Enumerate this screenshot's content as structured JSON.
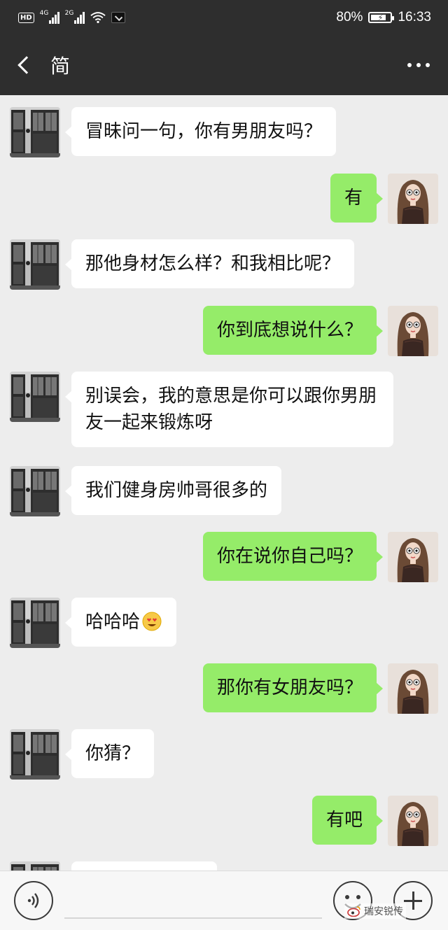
{
  "status_bar": {
    "hd": "HD",
    "network1": "4G",
    "network2": "2G",
    "battery_percent": "80%",
    "battery_level": 0.8,
    "time": "16:33"
  },
  "header": {
    "title": "简",
    "back_icon": "chevron-left-icon",
    "more_icon": "more-dots-icon"
  },
  "messages": [
    {
      "side": "left",
      "text": "冒昧问一句，你有男朋友吗？"
    },
    {
      "side": "right",
      "text": "有"
    },
    {
      "side": "left",
      "text": "那他身材怎么样？和我相比呢？"
    },
    {
      "side": "right",
      "text": "你到底想说什么？"
    },
    {
      "side": "left",
      "text": "别误会，我的意思是你可以跟你男朋友一起来锻炼呀"
    },
    {
      "side": "left",
      "text": "我们健身房帅哥很多的"
    },
    {
      "side": "right",
      "text": "你在说你自己吗？"
    },
    {
      "side": "left",
      "text": "哈哈哈",
      "emoji": "heart-eyes-emoji"
    },
    {
      "side": "right",
      "text": "那你有女朋友吗？"
    },
    {
      "side": "left",
      "text": "你猜？"
    },
    {
      "side": "right",
      "text": "有吧"
    },
    {
      "side": "left",
      "text": ""
    }
  ],
  "input_bar": {
    "voice_icon": "voice-icon",
    "input_value": "",
    "emoji_icon": "smiley-icon",
    "plus_icon": "plus-icon",
    "watermark": "瑞安锐传"
  },
  "colors": {
    "bar_bg": "#2e2e2e",
    "chat_bg": "#ededed",
    "sent_bubble": "#95ec69",
    "received_bubble": "#ffffff"
  }
}
